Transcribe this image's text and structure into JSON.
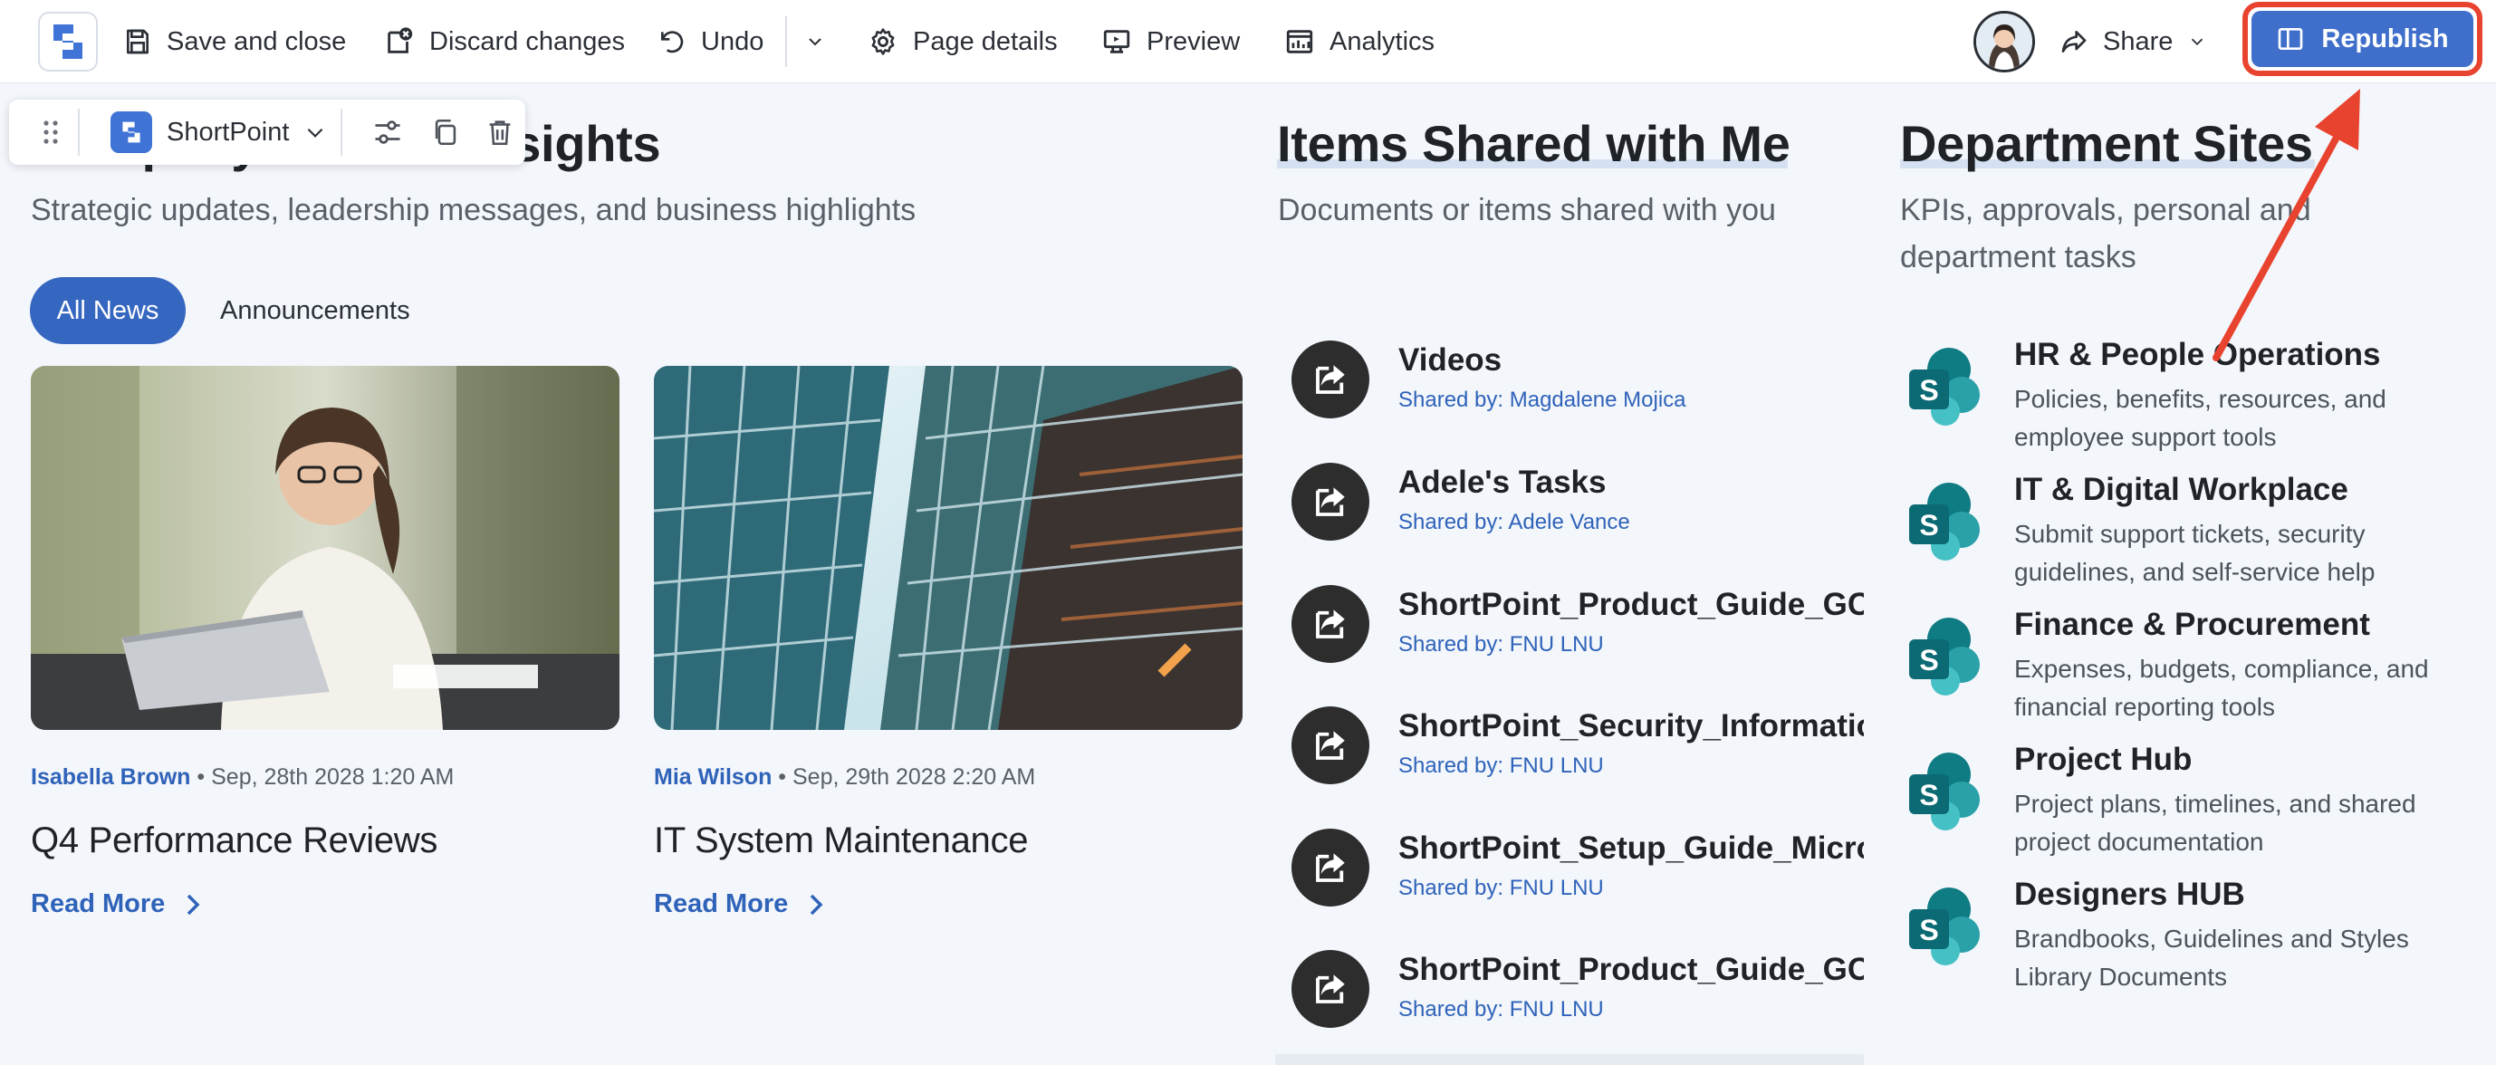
{
  "toolbar": {
    "save_close": "Save and close",
    "discard": "Discard changes",
    "undo": "Undo",
    "page_details": "Page details",
    "preview": "Preview",
    "analytics": "Analytics",
    "share": "Share",
    "republish": "Republish"
  },
  "webpart_toolbar": {
    "label": "ShortPoint"
  },
  "news": {
    "title": "Company News & Insights",
    "subtitle": "Strategic updates, leadership messages, and business highlights",
    "tabs": [
      "All News",
      "Announcements"
    ],
    "articles": [
      {
        "author": "Isabella Brown",
        "date": "Sep, 28th 2028 1:20 AM",
        "title": "Q4 Performance Reviews",
        "link": "Read More"
      },
      {
        "author": "Mia Wilson",
        "date": "Sep, 29th 2028 2:20 AM",
        "title": "IT System Maintenance",
        "link": "Read More"
      }
    ]
  },
  "shared": {
    "title": "Items Shared with Me",
    "subtitle": "Documents or items shared with you",
    "items": [
      {
        "name": "Videos",
        "by": "Shared by: Magdalene Mojica"
      },
      {
        "name": "Adele's Tasks",
        "by": "Shared by: Adele Vance"
      },
      {
        "name": "ShortPoint_Product_Guide_GCC",
        "by": "Shared by: FNU LNU"
      },
      {
        "name": "ShortPoint_Security_Information",
        "by": "Shared by: FNU LNU"
      },
      {
        "name": "ShortPoint_Setup_Guide_Microsoft",
        "by": "Shared by: FNU LNU"
      },
      {
        "name": "ShortPoint_Product_Guide_GCC",
        "by": "Shared by: FNU LNU"
      }
    ]
  },
  "departments": {
    "title": "Department Sites",
    "subtitle": "KPIs, approvals, personal and department tasks",
    "items": [
      {
        "name": "HR & People Operations",
        "desc": "Policies, benefits, resources, and employee support tools"
      },
      {
        "name": "IT & Digital Workplace",
        "desc": "Submit support tickets, security guidelines, and self-service help"
      },
      {
        "name": "Finance & Procurement",
        "desc": "Expenses, budgets, compliance, and financial reporting tools"
      },
      {
        "name": "Project Hub",
        "desc": "Project plans, timelines, and shared project documentation"
      },
      {
        "name": "Designers HUB",
        "desc": "Brandbooks, Guidelines and Styles Library Documents"
      }
    ]
  },
  "colors": {
    "accent": "#3566c0",
    "link": "#2f63b9",
    "annotation": "#e8432f"
  }
}
